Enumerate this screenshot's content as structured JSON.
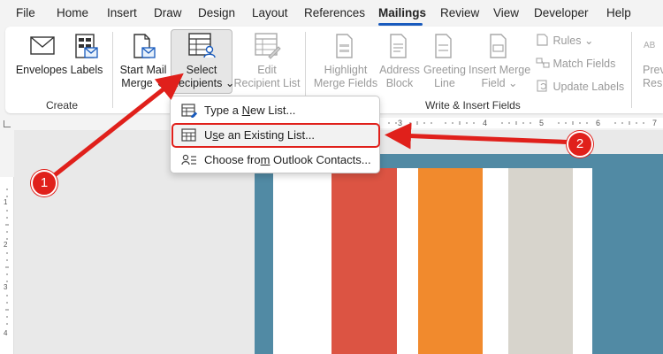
{
  "menu": {
    "tabs": [
      "File",
      "Home",
      "Insert",
      "Draw",
      "Design",
      "Layout",
      "References",
      "Mailings",
      "Review",
      "View",
      "Developer",
      "Help"
    ],
    "active_tab": "Mailings"
  },
  "ribbon": {
    "create": {
      "group_label": "Create",
      "envelopes_label": "Envelopes",
      "labels_label": "Labels"
    },
    "start_mail_merge": {
      "line1": "Start Mail",
      "line2": "Merge",
      "chevron": "⌄"
    },
    "select_recipients": {
      "line1": "Select",
      "line2": "Recipients",
      "chevron": "⌄"
    },
    "edit_recipient_list": {
      "line1": "Edit",
      "line2": "Recipient List"
    },
    "write_insert": {
      "group_label": "Write & Insert Fields",
      "highlight_line1": "Highlight",
      "highlight_line2": "Merge Fields",
      "address_line1": "Address",
      "address_line2": "Block",
      "greeting_line1": "Greeting",
      "greeting_line2": "Line",
      "insert_merge_line1": "Insert Merge",
      "insert_merge_line2": "Field",
      "insert_merge_chevron": "⌄",
      "rules_label": "Rules",
      "rules_chevron": "⌄",
      "match_fields_label": "Match Fields",
      "update_labels_label": "Update Labels"
    },
    "preview": {
      "line1": "Previ",
      "line2": "Resu"
    }
  },
  "dropdown": {
    "items": [
      {
        "prefix": "Type a ",
        "accel": "N",
        "suffix": "ew List..."
      },
      {
        "prefix": "U",
        "accel": "s",
        "suffix": "e an Existing List..."
      },
      {
        "prefix": "Choose fro",
        "accel": "m",
        "suffix": " Outlook Contacts..."
      }
    ]
  },
  "ruler": {
    "h_numbers": [
      "3",
      "4",
      "5",
      "6",
      "7"
    ],
    "v_numbers": [
      "1",
      "2",
      "3",
      "4"
    ]
  },
  "callouts": [
    "1",
    "2"
  ],
  "colors": {
    "accent": "#185abd",
    "annotation": "#e0201b",
    "page_blue": "#518aa4",
    "stripe_red": "#dc5443",
    "stripe_orange": "#f18a2d",
    "stripe_beige": "#d7d4cc"
  }
}
